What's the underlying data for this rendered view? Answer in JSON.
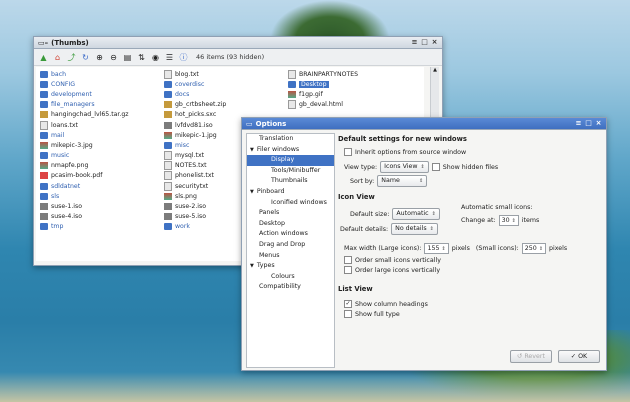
{
  "thumbs": {
    "title": "(Thumbs)",
    "status": "46 items (93 hidden)",
    "toolbar_icons": [
      "back-icon",
      "home-icon",
      "up-icon",
      "refresh-icon",
      "zoom-in-icon",
      "zoom-out-icon",
      "view-icon",
      "sort-icon",
      "eye-icon",
      "list-icon",
      "info-icon"
    ],
    "col1": [
      {
        "name": "bach",
        "kind": "dir"
      },
      {
        "name": "CONFIG",
        "kind": "dir"
      },
      {
        "name": "development",
        "kind": "dir"
      },
      {
        "name": "file_managers",
        "kind": "dir"
      },
      {
        "name": "hangingchad_lvl65.tar.gz",
        "kind": "arc"
      },
      {
        "name": "loans.txt",
        "kind": "doc"
      },
      {
        "name": "mail",
        "kind": "dir"
      },
      {
        "name": "mikepic-3.jpg",
        "kind": "img"
      },
      {
        "name": "music",
        "kind": "dir"
      },
      {
        "name": "nmapfe.png",
        "kind": "img"
      },
      {
        "name": "pcasim-book.pdf",
        "kind": "pdf"
      },
      {
        "name": "sdldatnet",
        "kind": "dir"
      },
      {
        "name": "sls",
        "kind": "dir"
      },
      {
        "name": "suse-1.iso",
        "kind": "iso"
      },
      {
        "name": "suse-4.iso",
        "kind": "iso"
      },
      {
        "name": "tmp",
        "kind": "dir"
      }
    ],
    "col2": [
      {
        "name": "blog.txt",
        "kind": "doc"
      },
      {
        "name": "coverdisc",
        "kind": "dir"
      },
      {
        "name": "docs",
        "kind": "dir"
      },
      {
        "name": "gb_crtbsheet.zip",
        "kind": "arc"
      },
      {
        "name": "hot_picks.sxc",
        "kind": "arc"
      },
      {
        "name": "lvfdvd81.iso",
        "kind": "iso"
      },
      {
        "name": "mikepic-1.jpg",
        "kind": "img"
      },
      {
        "name": "misc",
        "kind": "dir"
      },
      {
        "name": "mysql.txt",
        "kind": "doc"
      },
      {
        "name": "NOTES.txt",
        "kind": "doc"
      },
      {
        "name": "phonelist.txt",
        "kind": "doc"
      },
      {
        "name": "securitytxt",
        "kind": "doc"
      },
      {
        "name": "sls.png",
        "kind": "img"
      },
      {
        "name": "suse-2.iso",
        "kind": "iso"
      },
      {
        "name": "suse-5.iso",
        "kind": "iso"
      },
      {
        "name": "work",
        "kind": "dir"
      }
    ],
    "col3": [
      {
        "name": "BRAINPARTYNOTES",
        "kind": "doc"
      },
      {
        "name": "Desktop",
        "kind": "dir",
        "selected": true
      },
      {
        "name": "f1gp.gif",
        "kind": "img"
      },
      {
        "name": "gb_deval.html",
        "kind": "doc"
      }
    ]
  },
  "options": {
    "title": "Options",
    "nav": [
      {
        "label": "Translation",
        "level": "l0"
      },
      {
        "label": "Filer windows",
        "level": "l0e",
        "expander": "▼"
      },
      {
        "label": "Display",
        "level": "l1",
        "selected": true
      },
      {
        "label": "Tools/Minibuffer",
        "level": "l1"
      },
      {
        "label": "Thumbnails",
        "level": "l1"
      },
      {
        "label": "Pinboard",
        "level": "l0e",
        "expander": "▼"
      },
      {
        "label": "Iconified windows",
        "level": "l1"
      },
      {
        "label": "Panels",
        "level": "l0"
      },
      {
        "label": "Desktop",
        "level": "l0"
      },
      {
        "label": "Action windows",
        "level": "l0"
      },
      {
        "label": "Drag and Drop",
        "level": "l0"
      },
      {
        "label": "Menus",
        "level": "l0"
      },
      {
        "label": "Types",
        "level": "l0e",
        "expander": "▼"
      },
      {
        "label": "Colours",
        "level": "l1"
      },
      {
        "label": "Compatibility",
        "level": "l0"
      }
    ],
    "pane": {
      "heading_default": "Default settings for new windows",
      "inherit_label": "Inherit options from source window",
      "view_type_label": "View type:",
      "view_type_value": "Icons View",
      "show_hidden_label": "Show hidden files",
      "sort_by_label": "Sort by:",
      "sort_by_value": "Name",
      "heading_icon": "Icon View",
      "default_size_label": "Default size:",
      "default_size_value": "Automatic",
      "auto_small_label": "Automatic small icons:",
      "change_at_label": "Change at:",
      "change_at_value": "30",
      "items_label": "items",
      "default_details_label": "Default details:",
      "default_details_value": "No details",
      "max_width_label": "Max width (Large icons):",
      "max_width_large": "155",
      "pixels1": "pixels",
      "small_icons_label": "(Small icons):",
      "max_width_small": "250",
      "pixels2": "pixels",
      "order_small_label": "Order small icons vertically",
      "order_large_label": "Order large icons vertically",
      "heading_list": "List View",
      "show_col_label": "Show column headings",
      "show_full_label": "Show full type"
    },
    "revert_label": "Revert",
    "ok_label": "OK"
  }
}
